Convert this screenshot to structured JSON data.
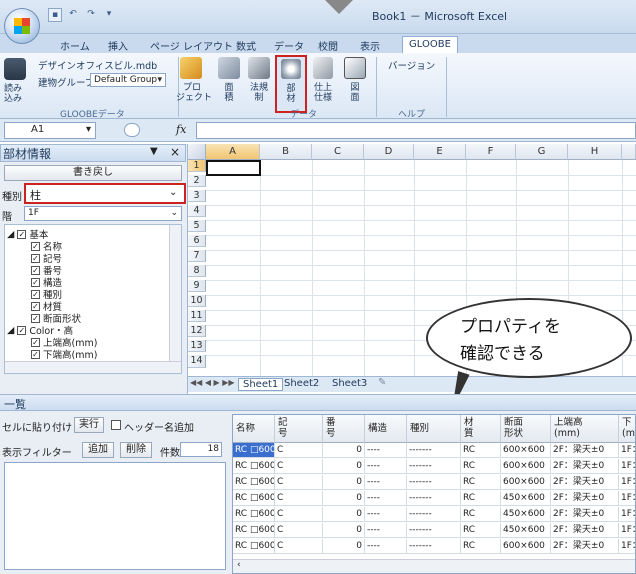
{
  "window": {
    "title": "Book1 － Microsoft Excel",
    "qat_icons": [
      "save-icon",
      "undo-icon",
      "redo-icon",
      "dropdown-icon"
    ]
  },
  "ribbon": {
    "tabs": [
      "ホーム",
      "挿入",
      "ページ レイアウト",
      "数式",
      "データ",
      "校閲",
      "表示",
      "GLOOBE"
    ],
    "active_tab": "GLOOBE",
    "design_file": "デザインオフィスビル.mdb",
    "building_group_label": "建物グループ",
    "building_group_value": "Default Group",
    "load_label": "読み\n込み",
    "group1_label": "GLOOBEデータ",
    "buttons": [
      "プロ\nジェクト",
      "面\n積",
      "法規\n制",
      "部\n材",
      "仕上\n仕様",
      "図\n面"
    ],
    "group2_label": "データ",
    "version_label": "バージョン",
    "group3_label": "ヘルプ"
  },
  "formula_bar": {
    "name_box": "A1",
    "fx": "fx"
  },
  "panel": {
    "title": "部材情報",
    "writeback_button": "書き戻し",
    "kind_label": "種別",
    "kind_value": "柱",
    "floor_label": "階",
    "floor_value": "1F",
    "tree": [
      {
        "label": "基本",
        "level": 0,
        "expander": true
      },
      {
        "label": "名称",
        "level": 1
      },
      {
        "label": "記号",
        "level": 1
      },
      {
        "label": "番号",
        "level": 1
      },
      {
        "label": "構造",
        "level": 1
      },
      {
        "label": "種別",
        "level": 1
      },
      {
        "label": "材質",
        "level": 1
      },
      {
        "label": "断面形状",
        "level": 1
      },
      {
        "label": "Color・高",
        "level": 0,
        "expander": true
      },
      {
        "label": "上端高(mm)",
        "level": 1
      },
      {
        "label": "下端高(mm)",
        "level": 1
      }
    ]
  },
  "sheet": {
    "columns": [
      "A",
      "B",
      "C",
      "D",
      "E",
      "F",
      "G",
      "H"
    ],
    "rows": [
      "1",
      "2",
      "3",
      "4",
      "5",
      "6",
      "7",
      "8",
      "9",
      "10",
      "11",
      "12",
      "13",
      "14"
    ],
    "tabs": [
      "Sheet1",
      "Sheet2",
      "Sheet3"
    ]
  },
  "callout": "プロパティを\n確認できる",
  "list": {
    "title": "一覧",
    "paste_label": "セルに貼り付け",
    "run_button": "実行",
    "header_name_label": "ヘッダー名追加",
    "filter_label": "表示フィルター",
    "add_button": "追加",
    "delete_button": "削除",
    "count_label": "件数",
    "count_value": "18",
    "headers": [
      "名称",
      "記\n号",
      "番\n号",
      "構造",
      "種別",
      "材\n質",
      "断面\n形状",
      "上端高\n(mm)",
      "下\n(m"
    ],
    "rows": [
      [
        "RC □600",
        "C",
        "0",
        "----",
        "-------",
        "RC",
        "600×600",
        "2F：梁天±0",
        "1F："
      ],
      [
        "RC □600",
        "C",
        "0",
        "----",
        "-------",
        "RC",
        "600×600",
        "2F：梁天±0",
        "1F："
      ],
      [
        "RC □600",
        "C",
        "0",
        "----",
        "-------",
        "RC",
        "600×600",
        "2F：梁天±0",
        "1F："
      ],
      [
        "RC □600",
        "C",
        "0",
        "----",
        "-------",
        "RC",
        "450×600",
        "2F：梁天±0",
        "1F："
      ],
      [
        "RC □600",
        "C",
        "0",
        "----",
        "-------",
        "RC",
        "450×600",
        "2F：梁天±0",
        "1F："
      ],
      [
        "RC □600",
        "C",
        "0",
        "----",
        "-------",
        "RC",
        "450×600",
        "2F：梁天±0",
        "1F："
      ],
      [
        "RC □600",
        "C",
        "0",
        "----",
        "-------",
        "RC",
        "600×600",
        "2F：梁天±0",
        "1F："
      ]
    ]
  }
}
